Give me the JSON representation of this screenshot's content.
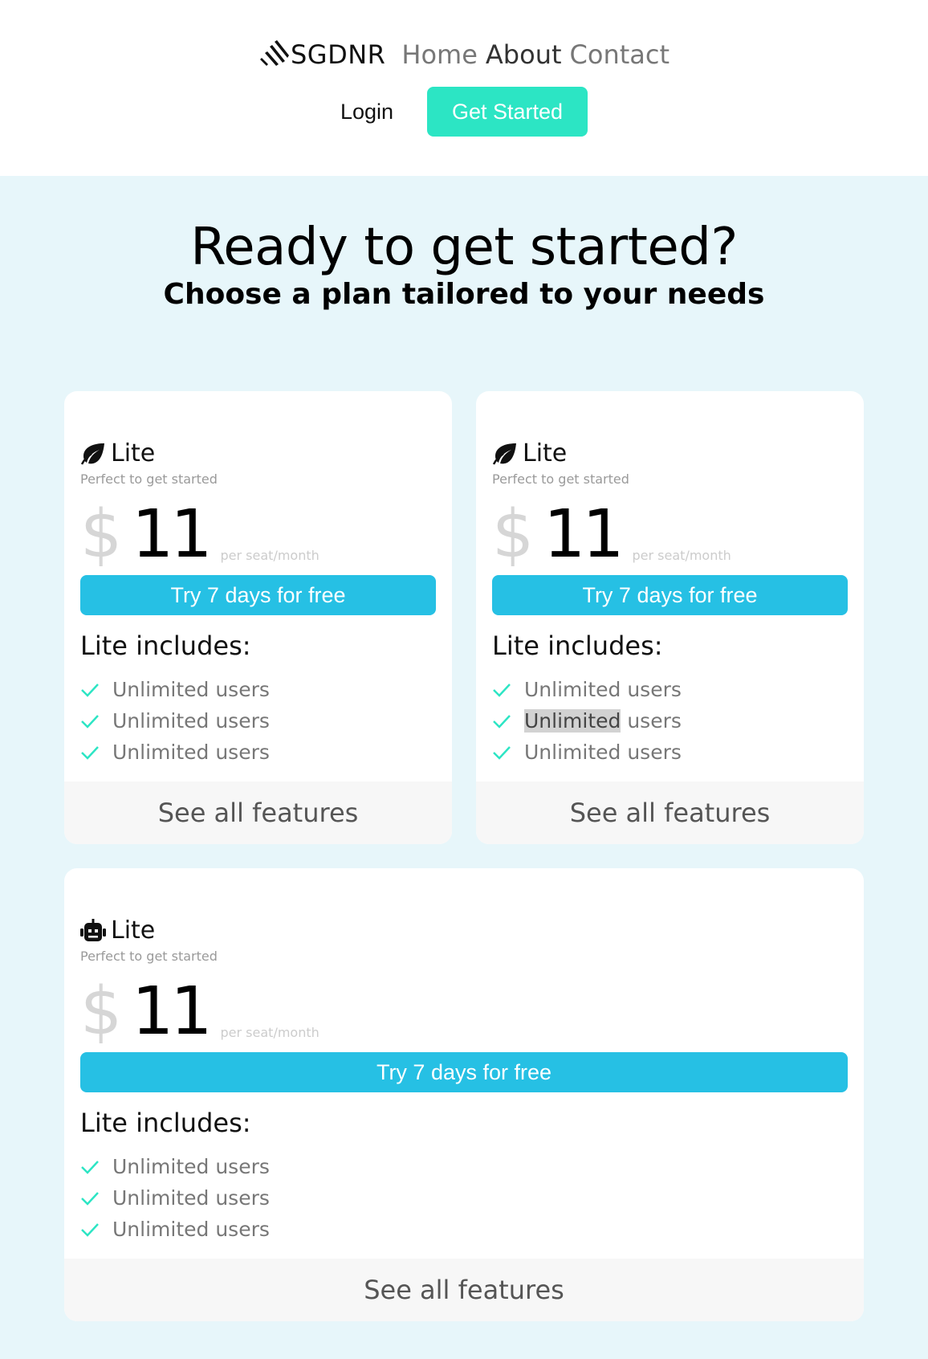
{
  "header": {
    "brand": "SGDNR",
    "nav": {
      "home": "Home",
      "about": "About",
      "contact": "Contact"
    },
    "login_label": "Login",
    "get_started_label": "Get Started"
  },
  "hero": {
    "title": "Ready to get started?",
    "subtitle": "Choose a plan tailored to your needs"
  },
  "plans": [
    {
      "icon": "leaf-icon",
      "name": "Lite",
      "tagline": "Perfect to get started",
      "currency": "$",
      "price": "11",
      "period": "per seat/month",
      "cta": "Try 7 days for free",
      "includes_title": "Lite includes:",
      "features": [
        "Unlimited users",
        "Unlimited users",
        "Unlimited users"
      ],
      "see_all": "See all features"
    },
    {
      "icon": "leaf-icon",
      "name": "Lite",
      "tagline": "Perfect to get started",
      "currency": "$",
      "price": "11",
      "period": "per seat/month",
      "cta": "Try 7 days for free",
      "includes_title": "Lite includes:",
      "features": [
        "Unlimited users",
        "Unlimited users",
        "Unlimited users"
      ],
      "highlight": {
        "word": "Unlimited",
        "rest": " users"
      },
      "see_all": "See all features"
    },
    {
      "icon": "robot-icon",
      "name": "Lite",
      "tagline": "Perfect to get started",
      "currency": "$",
      "price": "11",
      "period": "per seat/month",
      "cta": "Try 7 days for free",
      "includes_title": "Lite includes:",
      "features": [
        "Unlimited users",
        "Unlimited users",
        "Unlimited users"
      ],
      "see_all": "See all features"
    }
  ],
  "colors": {
    "accent_teal": "#2ce5c4",
    "cta_blue": "#26c0e4",
    "page_bg": "#e7f6fa",
    "check": "#2ce5c4"
  }
}
